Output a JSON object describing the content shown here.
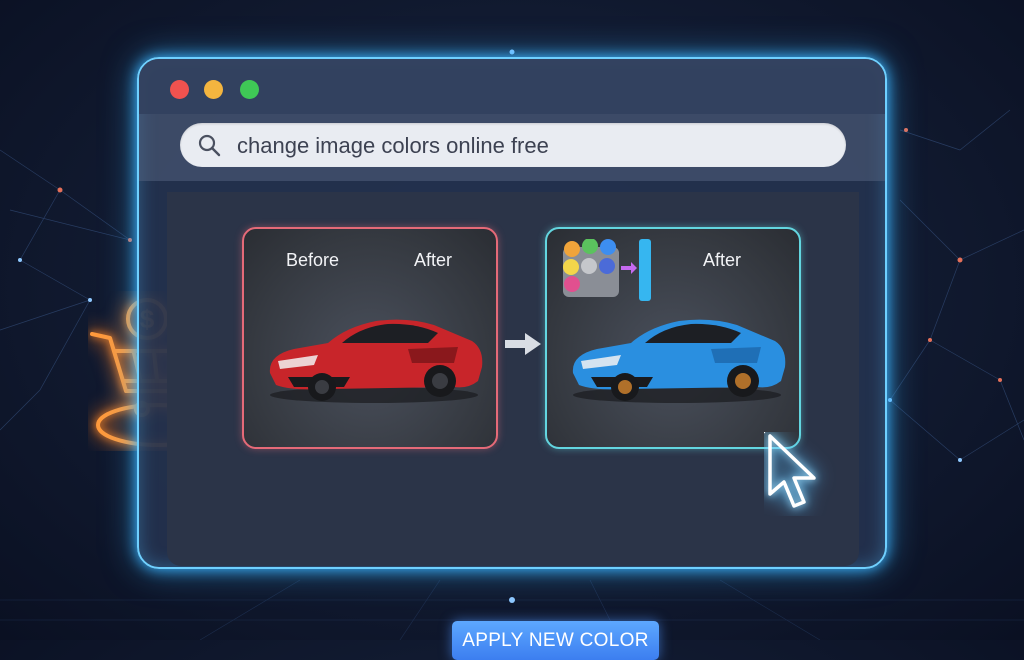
{
  "window": {
    "controls": [
      "close",
      "minimize",
      "maximize"
    ]
  },
  "search": {
    "value": "change image colors online free",
    "icon": "search-icon"
  },
  "before_panel": {
    "before_label": "Before",
    "after_label": "After",
    "car_color": "#c8252a"
  },
  "after_panel": {
    "after_label": "After",
    "car_color": "#2a8fe0",
    "palette_colors": [
      "#f0a43a",
      "#5bc35e",
      "#3d8ef0",
      "#f3d64a",
      "#c5c7cb",
      "#4b6bd8",
      "#e1508f"
    ]
  },
  "action": {
    "apply_label": "APPLY NEW COLOR"
  },
  "colors": {
    "accent_glow": "#6fd0ff",
    "before_border": "#e56a78",
    "after_border": "#63d6e0",
    "button": "#4a90f5",
    "neon_orange": "#ff9a3c"
  }
}
